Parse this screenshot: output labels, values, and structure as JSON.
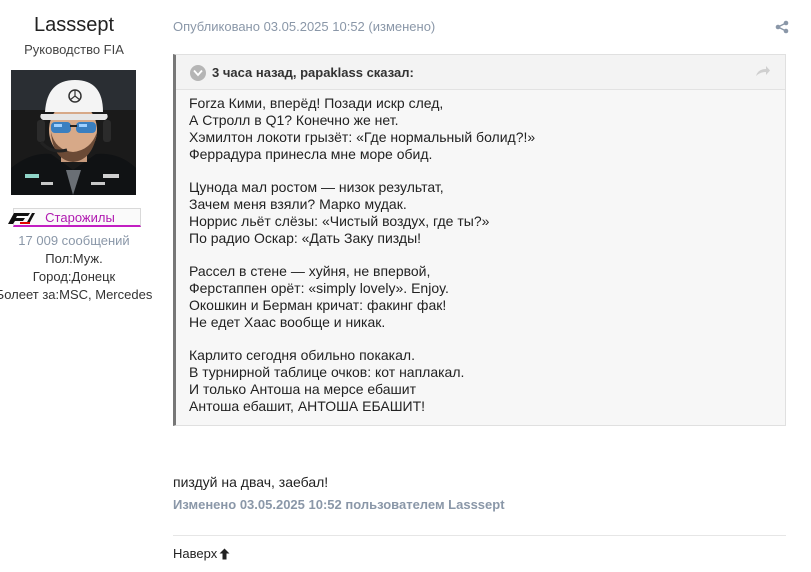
{
  "author": {
    "name": "Lasssept",
    "title": "Руководство FIA",
    "group_label": "Старожилы",
    "post_count": "17 009 сообщений",
    "gender": "Пол:Муж.",
    "city": "Город:Донецк",
    "supports": "Болеет за:MSC, Mercedes",
    "group_icon": "f1-logo-icon",
    "colors": {
      "group_accent": "#b01ab0",
      "muted": "#8a97a8"
    }
  },
  "post": {
    "meta": "Опубликовано 03.05.2025 10:52 (изменено)",
    "share_icon": "share-icon",
    "quote": {
      "citation": "3 часа назад, papaklass сказал:",
      "stanzas": [
        [
          "Forza Кими, вперёд! Позади искр след,",
          "А Стролл в Q1? Конечно же нет.",
          "Хэмилтон локоти грызёт: «Где нормальный болид?!»",
          "Феррадура принесла мне море обид."
        ],
        [
          "Цунода мал ростом — низок результат,",
          "Зачем меня взяли? Марко мудак.",
          "Норрис льёт слёзы: «Чистый воздух, где ты?»",
          "По радио Оскар: «Дать Заку пизды!"
        ],
        [
          "Рассел в стене — хуйня, не впервой,",
          "Ферстаппен орёт: «simply lovely». Enjoy.",
          "Окошкин и Берман кричат: факинг фак!",
          "Не едет Хаас вообще и никак."
        ],
        [
          "Карлито сегодня обильно покакал.",
          "В турнирной таблице очков: кот наплакал.",
          "И только Антоша на мерсе ебашит",
          "Антоша ебашит, АНТОША ЕБАШИТ!"
        ]
      ]
    },
    "reply": "пиздуй на двач, заебал!",
    "edited_note": "Изменено 03.05.2025 10:52 пользователем Lasssept",
    "back_to_top": "Наверх"
  }
}
